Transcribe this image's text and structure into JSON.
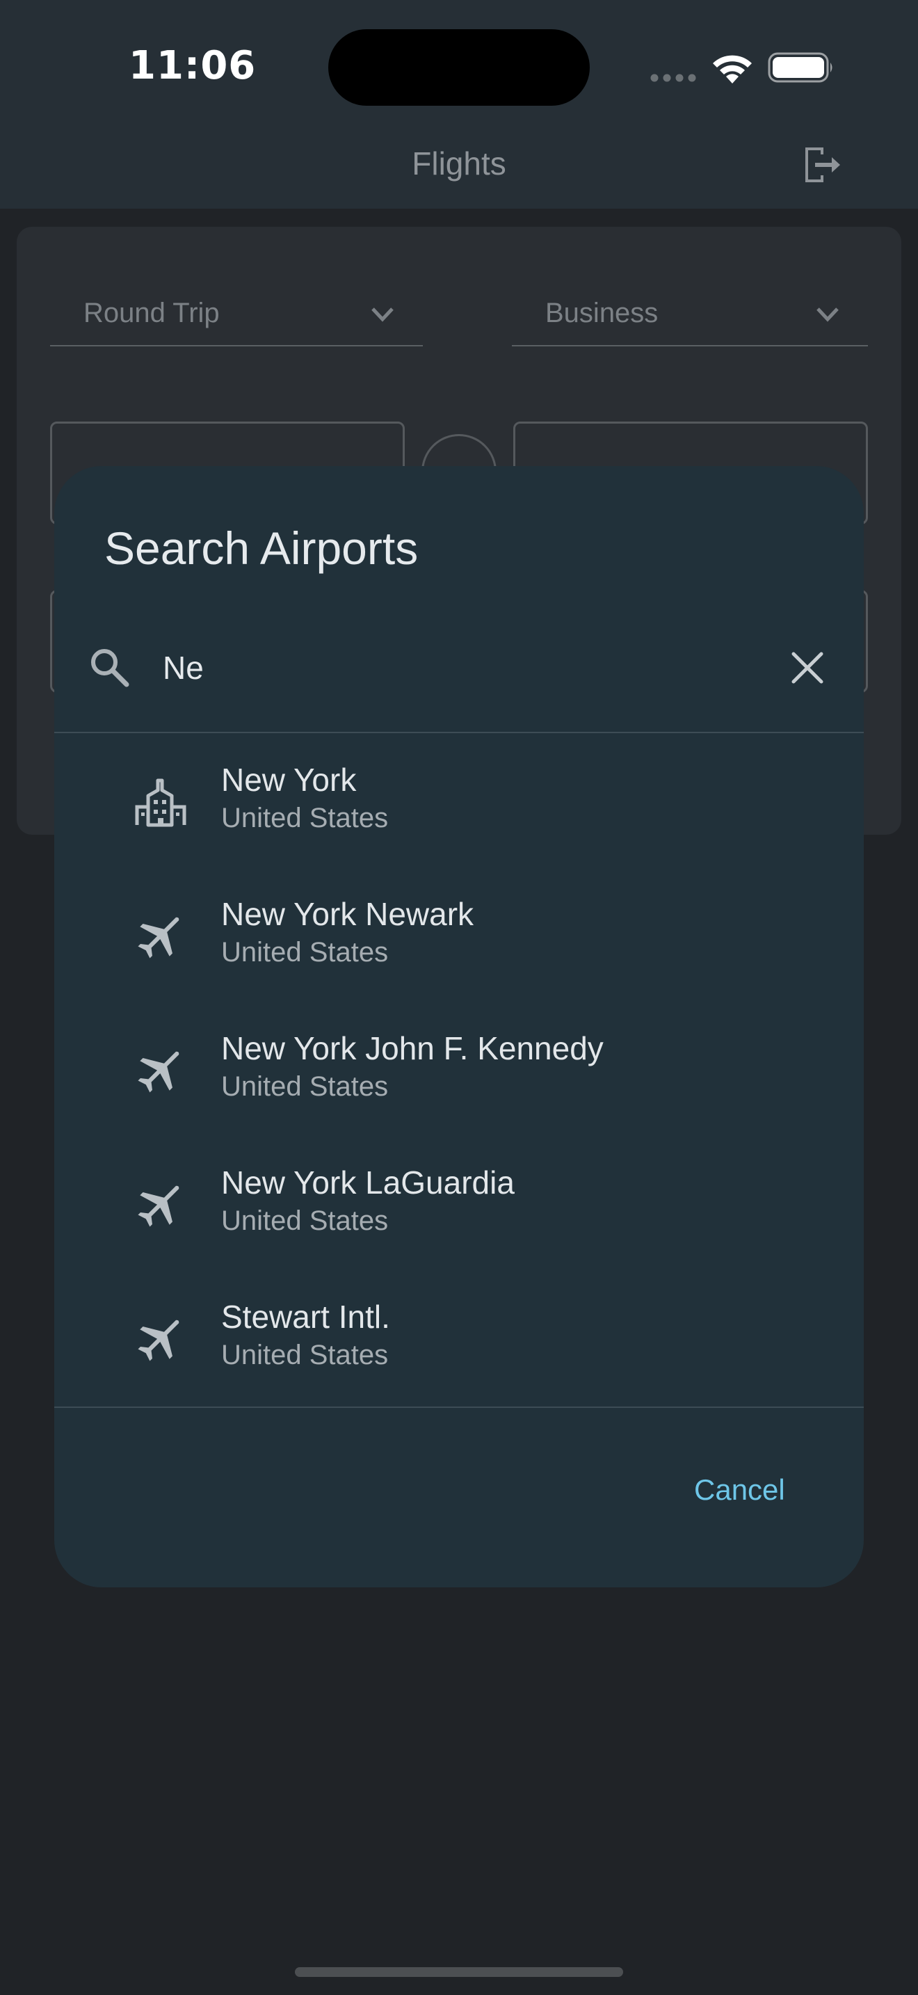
{
  "status_bar": {
    "time": "11:06"
  },
  "app_bar": {
    "title": "Flights",
    "logout_icon": "logout-icon"
  },
  "search_form": {
    "trip_type": "Round Trip",
    "cabin_class": "Business"
  },
  "dialog": {
    "title": "Search Airports",
    "search": {
      "value": "Ne",
      "icon": "search-icon",
      "clear_icon": "close-icon"
    },
    "results": [
      {
        "name": "New York",
        "country": "United States",
        "icon": "city-icon"
      },
      {
        "name": "New York Newark",
        "country": "United States",
        "icon": "airplane-icon"
      },
      {
        "name": "New York John F. Kennedy",
        "country": "United States",
        "icon": "airplane-icon"
      },
      {
        "name": "New York LaGuardia",
        "country": "United States",
        "icon": "airplane-icon"
      },
      {
        "name": "Stewart Intl.",
        "country": "United States",
        "icon": "airplane-icon"
      }
    ],
    "cancel_label": "Cancel"
  },
  "colors": {
    "background": "#202327",
    "app_bar": "#262f36",
    "dialog": "#21313a",
    "accent": "#6ec6e8"
  }
}
